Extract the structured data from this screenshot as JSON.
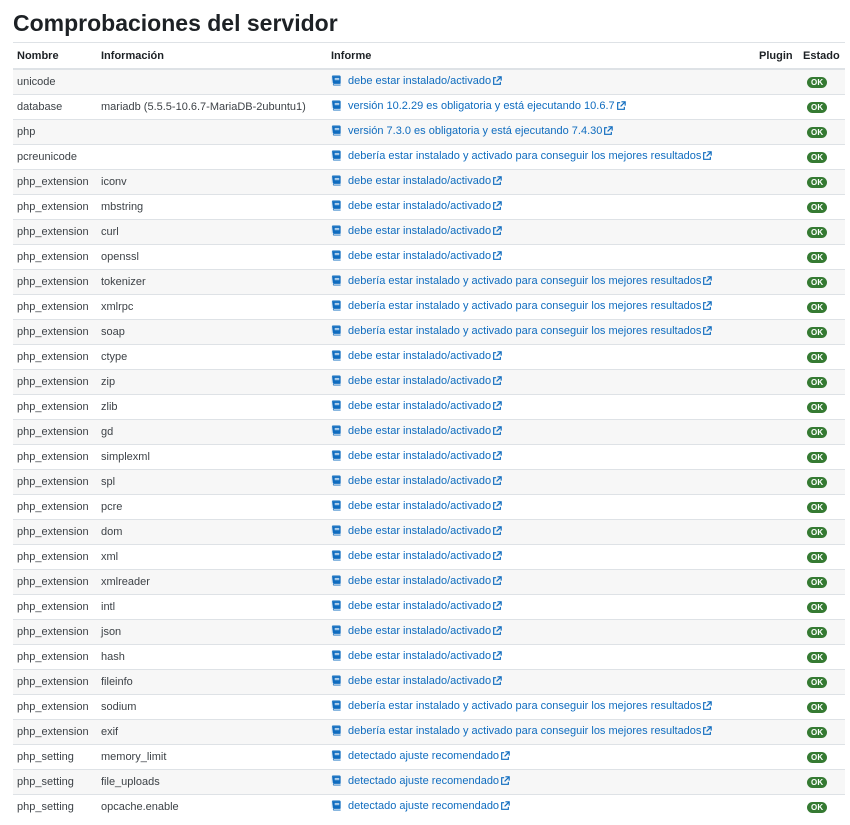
{
  "page_title": "Comprobaciones del servidor",
  "columns": {
    "name": "Nombre",
    "info": "Información",
    "report": "Informe",
    "plugin": "Plugin",
    "status": "Estado"
  },
  "status_color": "#357a32",
  "link_color": "#0f6cbf",
  "rows": [
    {
      "name": "unicode",
      "info": "",
      "report": "debe estar instalado/activado",
      "plugin": "",
      "status": "OK"
    },
    {
      "name": "database",
      "info": "mariadb (5.5.5-10.6.7-MariaDB-2ubuntu1)",
      "report": "versión 10.2.29 es obligatoria y está ejecutando 10.6.7",
      "plugin": "",
      "status": "OK"
    },
    {
      "name": "php",
      "info": "",
      "report": "versión 7.3.0 es obligatoria y está ejecutando 7.4.30",
      "plugin": "",
      "status": "OK"
    },
    {
      "name": "pcreunicode",
      "info": "",
      "report": "debería estar instalado y activado para conseguir los mejores resultados",
      "plugin": "",
      "status": "OK"
    },
    {
      "name": "php_extension",
      "info": "iconv",
      "report": "debe estar instalado/activado",
      "plugin": "",
      "status": "OK"
    },
    {
      "name": "php_extension",
      "info": "mbstring",
      "report": "debe estar instalado/activado",
      "plugin": "",
      "status": "OK"
    },
    {
      "name": "php_extension",
      "info": "curl",
      "report": "debe estar instalado/activado",
      "plugin": "",
      "status": "OK"
    },
    {
      "name": "php_extension",
      "info": "openssl",
      "report": "debe estar instalado/activado",
      "plugin": "",
      "status": "OK"
    },
    {
      "name": "php_extension",
      "info": "tokenizer",
      "report": "debería estar instalado y activado para conseguir los mejores resultados",
      "plugin": "",
      "status": "OK"
    },
    {
      "name": "php_extension",
      "info": "xmlrpc",
      "report": "debería estar instalado y activado para conseguir los mejores resultados",
      "plugin": "",
      "status": "OK"
    },
    {
      "name": "php_extension",
      "info": "soap",
      "report": "debería estar instalado y activado para conseguir los mejores resultados",
      "plugin": "",
      "status": "OK"
    },
    {
      "name": "php_extension",
      "info": "ctype",
      "report": "debe estar instalado/activado",
      "plugin": "",
      "status": "OK"
    },
    {
      "name": "php_extension",
      "info": "zip",
      "report": "debe estar instalado/activado",
      "plugin": "",
      "status": "OK"
    },
    {
      "name": "php_extension",
      "info": "zlib",
      "report": "debe estar instalado/activado",
      "plugin": "",
      "status": "OK"
    },
    {
      "name": "php_extension",
      "info": "gd",
      "report": "debe estar instalado/activado",
      "plugin": "",
      "status": "OK"
    },
    {
      "name": "php_extension",
      "info": "simplexml",
      "report": "debe estar instalado/activado",
      "plugin": "",
      "status": "OK"
    },
    {
      "name": "php_extension",
      "info": "spl",
      "report": "debe estar instalado/activado",
      "plugin": "",
      "status": "OK"
    },
    {
      "name": "php_extension",
      "info": "pcre",
      "report": "debe estar instalado/activado",
      "plugin": "",
      "status": "OK"
    },
    {
      "name": "php_extension",
      "info": "dom",
      "report": "debe estar instalado/activado",
      "plugin": "",
      "status": "OK"
    },
    {
      "name": "php_extension",
      "info": "xml",
      "report": "debe estar instalado/activado",
      "plugin": "",
      "status": "OK"
    },
    {
      "name": "php_extension",
      "info": "xmlreader",
      "report": "debe estar instalado/activado",
      "plugin": "",
      "status": "OK"
    },
    {
      "name": "php_extension",
      "info": "intl",
      "report": "debe estar instalado/activado",
      "plugin": "",
      "status": "OK"
    },
    {
      "name": "php_extension",
      "info": "json",
      "report": "debe estar instalado/activado",
      "plugin": "",
      "status": "OK"
    },
    {
      "name": "php_extension",
      "info": "hash",
      "report": "debe estar instalado/activado",
      "plugin": "",
      "status": "OK"
    },
    {
      "name": "php_extension",
      "info": "fileinfo",
      "report": "debe estar instalado/activado",
      "plugin": "",
      "status": "OK"
    },
    {
      "name": "php_extension",
      "info": "sodium",
      "report": "debería estar instalado y activado para conseguir los mejores resultados",
      "plugin": "",
      "status": "OK"
    },
    {
      "name": "php_extension",
      "info": "exif",
      "report": "debería estar instalado y activado para conseguir los mejores resultados",
      "plugin": "",
      "status": "OK"
    },
    {
      "name": "php_setting",
      "info": "memory_limit",
      "report": "detectado ajuste recomendado",
      "plugin": "",
      "status": "OK"
    },
    {
      "name": "php_setting",
      "info": "file_uploads",
      "report": "detectado ajuste recomendado",
      "plugin": "",
      "status": "OK"
    },
    {
      "name": "php_setting",
      "info": "opcache.enable",
      "report": "detectado ajuste recomendado",
      "plugin": "",
      "status": "OK"
    }
  ]
}
